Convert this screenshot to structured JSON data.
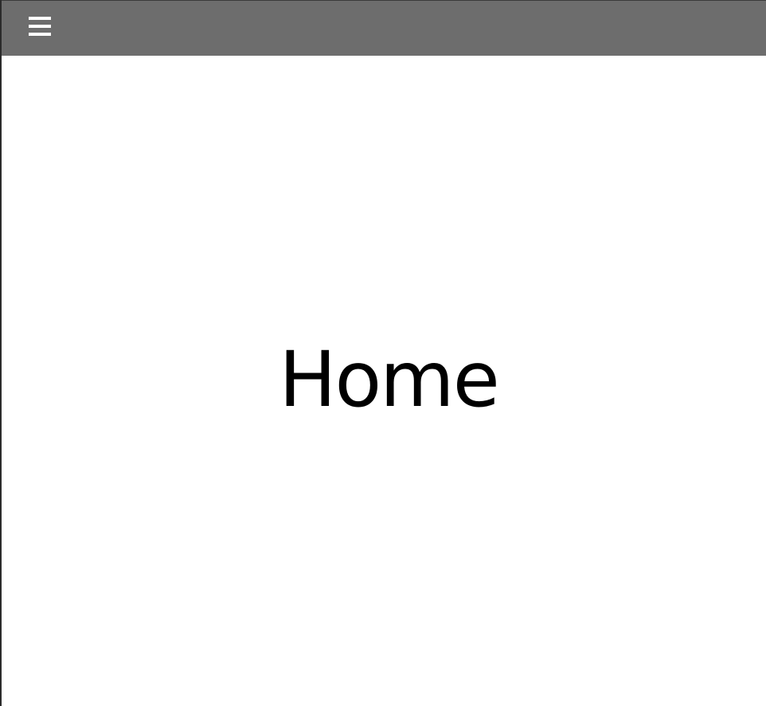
{
  "header": {
    "menu_icon": "hamburger-menu-icon",
    "background_color": "#6d6d6d",
    "icon_color": "#ffffff"
  },
  "main": {
    "title": "Home"
  }
}
